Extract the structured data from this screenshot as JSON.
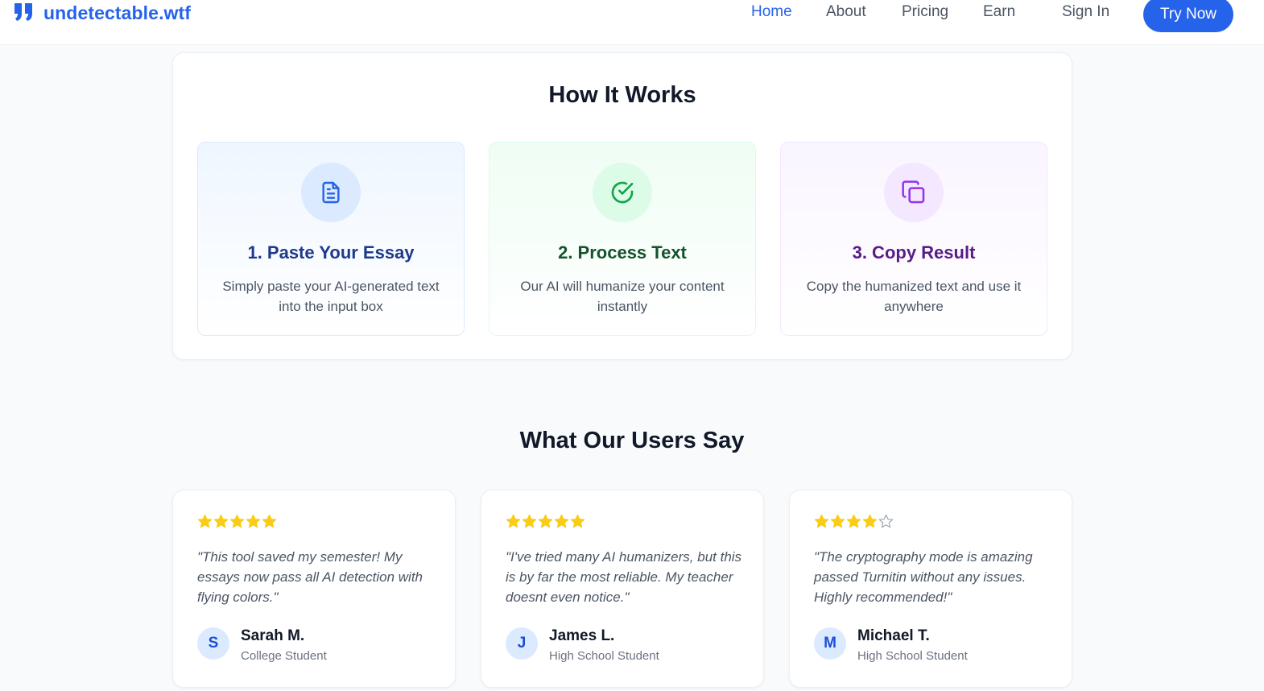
{
  "brand": {
    "name": "undetectable.wtf",
    "color": "#2563eb"
  },
  "nav": {
    "links": [
      "Home",
      "About",
      "Pricing",
      "Earn",
      "Sign In"
    ],
    "active": "Home",
    "cta": "Try Now"
  },
  "how_it_works": {
    "title": "How It Works",
    "steps": [
      {
        "title": "1. Paste Your Essay",
        "description": "Simply paste your AI-generated text into the input box",
        "icon": "document-icon",
        "accent": "#1e3a8a"
      },
      {
        "title": "2. Process Text",
        "description": "Our AI will humanize your content instantly",
        "icon": "check-circle-icon",
        "accent": "#14532d"
      },
      {
        "title": "3. Copy Result",
        "description": "Copy the humanized text and use it anywhere",
        "icon": "copy-icon",
        "accent": "#581c87"
      }
    ]
  },
  "testimonials": {
    "title": "What Our Users Say",
    "star_color": "#facc15",
    "items": [
      {
        "rating": 5,
        "max_rating": 5,
        "quote": "\"This tool saved my semester! My essays now pass all AI detection with flying colors.\"",
        "initial": "S",
        "name": "Sarah M.",
        "role": "College Student"
      },
      {
        "rating": 5,
        "max_rating": 5,
        "quote": "\"I've tried many AI humanizers, but this is by far the most reliable. My teacher doesnt even notice.\"",
        "initial": "J",
        "name": "James L.",
        "role": "High School Student"
      },
      {
        "rating": 4,
        "max_rating": 5,
        "quote": "\"The cryptography mode is amazing passed Turnitin without any issues. Highly recommended!\"",
        "initial": "M",
        "name": "Michael T.",
        "role": "High School Student"
      }
    ]
  }
}
